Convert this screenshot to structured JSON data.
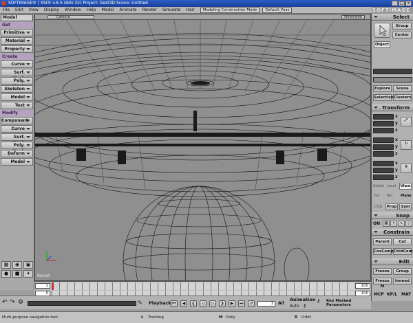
{
  "titlebar": {
    "title": "SOFTIMAGE® | XSI® v.6.5 (Adv 32) Project: Gest3D    Scene: Untitled",
    "min": "_",
    "max": "□",
    "close": "x"
  },
  "menu": {
    "items": [
      "File",
      "Edit",
      "View",
      "Display",
      "Window",
      "Help",
      "Model",
      "Animate",
      "Render",
      "Simulate",
      "Hair"
    ],
    "mode": "Modeling Construction Mode",
    "pass": "Default_Pass",
    "brand": "SOFTIMAGE"
  },
  "left": {
    "dropdown": "Model",
    "get": {
      "title": "Get",
      "items": [
        "Primitive",
        "Material",
        "Property"
      ]
    },
    "create": {
      "title": "Create",
      "items": [
        "Curve",
        "Surf. Mesh",
        "Poly. Mesh",
        "Skeleton",
        "Model",
        "Text"
      ]
    },
    "modify": {
      "title": "Modify",
      "items": [
        "Component",
        "Curve",
        "Surf. Mesh",
        "Poly. Mesh",
        "Deform",
        "Model"
      ]
    }
  },
  "viewport": {
    "camera": "Camera",
    "shading": "Wireframe",
    "label": "Result"
  },
  "right": {
    "select": {
      "title": "Select",
      "group": "Group",
      "center": "Center",
      "object": "Object",
      "explore": "Explore",
      "scene": "Scene",
      "selection": "Selection",
      "clusters": "Clusters"
    },
    "transform": {
      "title": "Transform",
      "axes": [
        "x",
        "y",
        "z"
      ],
      "global": "Global",
      "local": "Local",
      "view": "View",
      "par": "Par",
      "ref": "Ref",
      "plane": "Plane",
      "cog": "COG",
      "prop": "Prop",
      "sym": "Sym"
    },
    "snap": {
      "title": "Snap",
      "on": "ON"
    },
    "constrain": {
      "title": "Constrain",
      "parent": "Parent",
      "cut": "Cut",
      "cnscomp": "CnsComp",
      "chldcomp": "ChldComp"
    },
    "edit": {
      "title": "Edit",
      "freeze": "Freeze",
      "group": "Group",
      "freezem": "Freeze M",
      "immed": "Immed"
    },
    "tabs": {
      "mcp": "MCP",
      "kpl": "KP/L",
      "mat": "MAT"
    }
  },
  "timeline": {
    "start": "1",
    "end": "100",
    "start2": "0",
    "end2": "100",
    "end3": "100"
  },
  "playback": {
    "playback": "Playback",
    "all": "All",
    "animation": "Animation",
    "auto": "Auto",
    "key_params": "Key Marked Parameters",
    "frame": "1"
  },
  "status": {
    "tool": "Multi-purpose navigation tool",
    "l": "L",
    "tracking": "Tracking",
    "m": "M",
    "dolly": "Dolly",
    "r": "R",
    "orbit": "Orbit"
  }
}
